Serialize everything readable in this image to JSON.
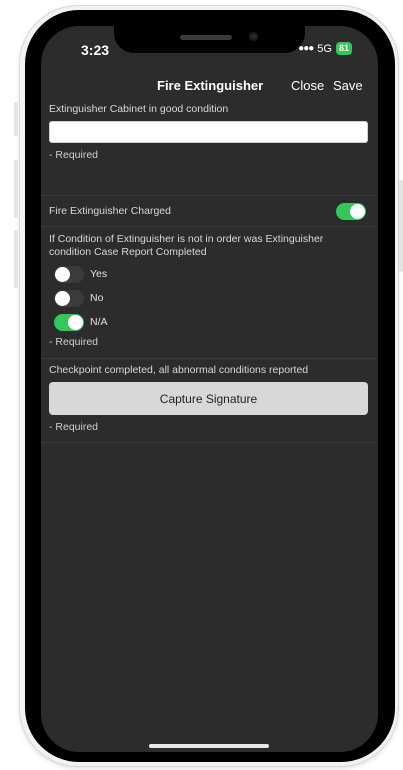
{
  "status_bar": {
    "time": "3:23",
    "network": "5G",
    "battery": "81"
  },
  "navbar": {
    "title": "Fire Extinguisher",
    "close_label": "Close",
    "save_label": "Save"
  },
  "form": {
    "cabinet": {
      "label": "Extinguisher Cabinet in good condition",
      "value": "",
      "required": "- Required"
    },
    "charged": {
      "label": "Fire Extinguisher Charged",
      "value": true
    },
    "case_report": {
      "label": "If Condition of Extinguisher is not in order was Extinguisher condition Case Report Completed",
      "options": [
        {
          "label": "Yes",
          "selected": false
        },
        {
          "label": "No",
          "selected": false
        },
        {
          "label": "N/A",
          "selected": true
        }
      ],
      "required": "- Required"
    },
    "checkpoint": {
      "label": "Checkpoint completed, all abnormal conditions reported",
      "button_label": "Capture Signature",
      "required": "- Required"
    }
  },
  "colors": {
    "screen_bg": "#2c2c2c",
    "toggle_on": "#34c759",
    "toggle_off": "#3b3b3b"
  }
}
